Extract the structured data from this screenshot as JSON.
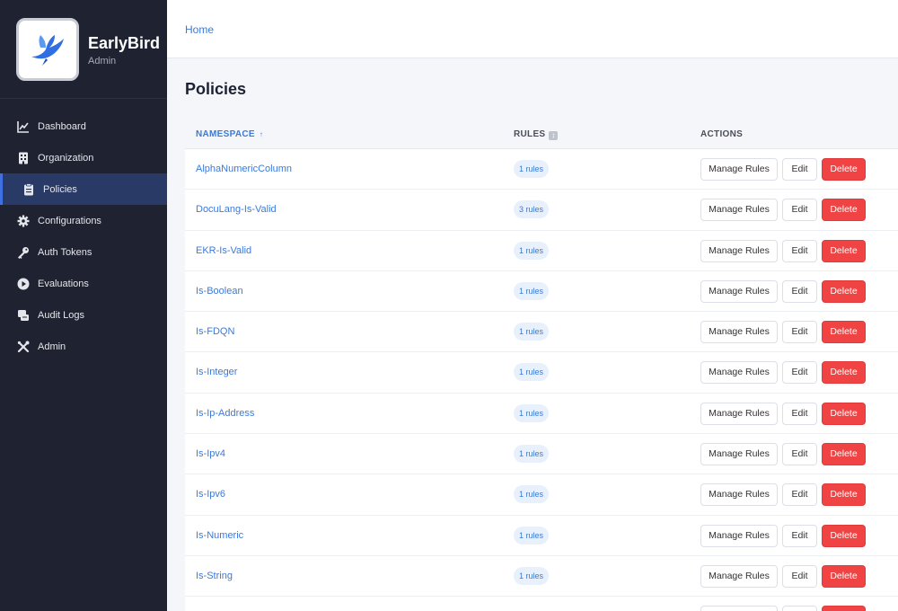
{
  "app": {
    "name": "EarlyBird",
    "role": "Admin",
    "logo_icon": "bird-logo-icon"
  },
  "sidebar": {
    "items": [
      {
        "label": "Dashboard",
        "icon": "chart-line-icon",
        "active": false
      },
      {
        "label": "Organization",
        "icon": "building-icon",
        "active": false
      },
      {
        "label": "Policies",
        "icon": "clipboard-icon",
        "active": true
      },
      {
        "label": "Configurations",
        "icon": "gear-icon",
        "active": false
      },
      {
        "label": "Auth Tokens",
        "icon": "key-icon",
        "active": false
      },
      {
        "label": "Evaluations",
        "icon": "play-circle-icon",
        "active": false
      },
      {
        "label": "Audit Logs",
        "icon": "scroll-icon",
        "active": false
      },
      {
        "label": "Admin",
        "icon": "tools-icon",
        "active": false
      }
    ]
  },
  "breadcrumb": {
    "home": "Home"
  },
  "page": {
    "title": "Policies"
  },
  "table": {
    "headers": {
      "namespace": "NAMESPACE",
      "rules": "RULES",
      "actions": "ACTIONS"
    },
    "actions": {
      "manage": "Manage Rules",
      "edit": "Edit",
      "delete": "Delete"
    },
    "rows": [
      {
        "namespace": "AlphaNumericColumn",
        "rules": "1 rules"
      },
      {
        "namespace": "DocuLang-Is-Valid",
        "rules": "3 rules"
      },
      {
        "namespace": "EKR-Is-Valid",
        "rules": "1 rules"
      },
      {
        "namespace": "Is-Boolean",
        "rules": "1 rules"
      },
      {
        "namespace": "Is-FDQN",
        "rules": "1 rules"
      },
      {
        "namespace": "Is-Integer",
        "rules": "1 rules"
      },
      {
        "namespace": "Is-Ip-Address",
        "rules": "1 rules"
      },
      {
        "namespace": "Is-Ipv4",
        "rules": "1 rules"
      },
      {
        "namespace": "Is-Ipv6",
        "rules": "1 rules"
      },
      {
        "namespace": "Is-Numeric",
        "rules": "1 rules"
      },
      {
        "namespace": "Is-String",
        "rules": "1 rules"
      },
      {
        "namespace": "",
        "rules": ""
      }
    ]
  },
  "colors": {
    "sidebar_bg": "#1f2230",
    "active_bg": "#2a3a66",
    "link": "#3b7ad8",
    "danger": "#f04343"
  }
}
